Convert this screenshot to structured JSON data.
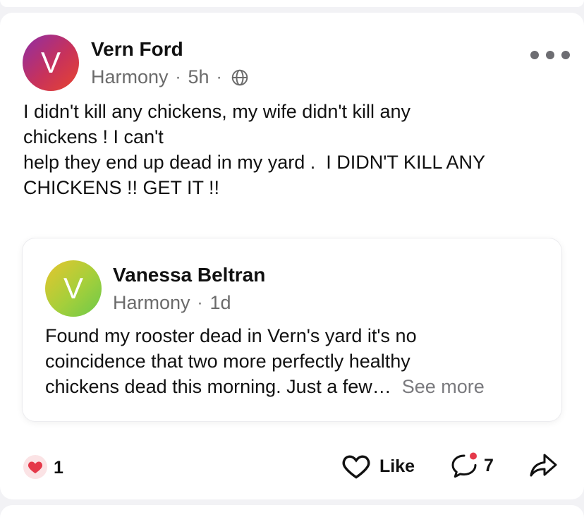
{
  "post": {
    "avatar_letter": "V",
    "author": "Vern Ford",
    "neighborhood": "Harmony",
    "separator": "·",
    "time": "5h",
    "visibility_icon": "globe-icon",
    "more_icon": "more-horizontal-icon",
    "body_lines": [
      "I didn't kill any chickens, my wife didn't kill any",
      "chickens ! I can't",
      "help they end up dead in my yard .  I DIDN'T KILL ANY",
      "CHICKENS !! GET IT !!"
    ]
  },
  "quoted_post": {
    "avatar_letter": "V",
    "author": "Vanessa Beltran",
    "neighborhood": "Harmony",
    "separator": "·",
    "time": "1d",
    "body_lines": [
      "Found my rooster dead in Vern's yard it's no",
      "coincidence that two more perfectly healthy",
      "chickens dead this morning. Just a few…"
    ],
    "see_more": "See more"
  },
  "actions": {
    "reaction_icon": "heart-icon",
    "reaction_count": "1",
    "like_label": "Like",
    "comment_count": "7",
    "share_icon": "share-icon"
  },
  "colors": {
    "background": "#f2f2f5",
    "card": "#ffffff",
    "reaction_heart": "#e5394a",
    "notification_dot": "#e5394a",
    "secondary_text": "#6b6b6b"
  }
}
